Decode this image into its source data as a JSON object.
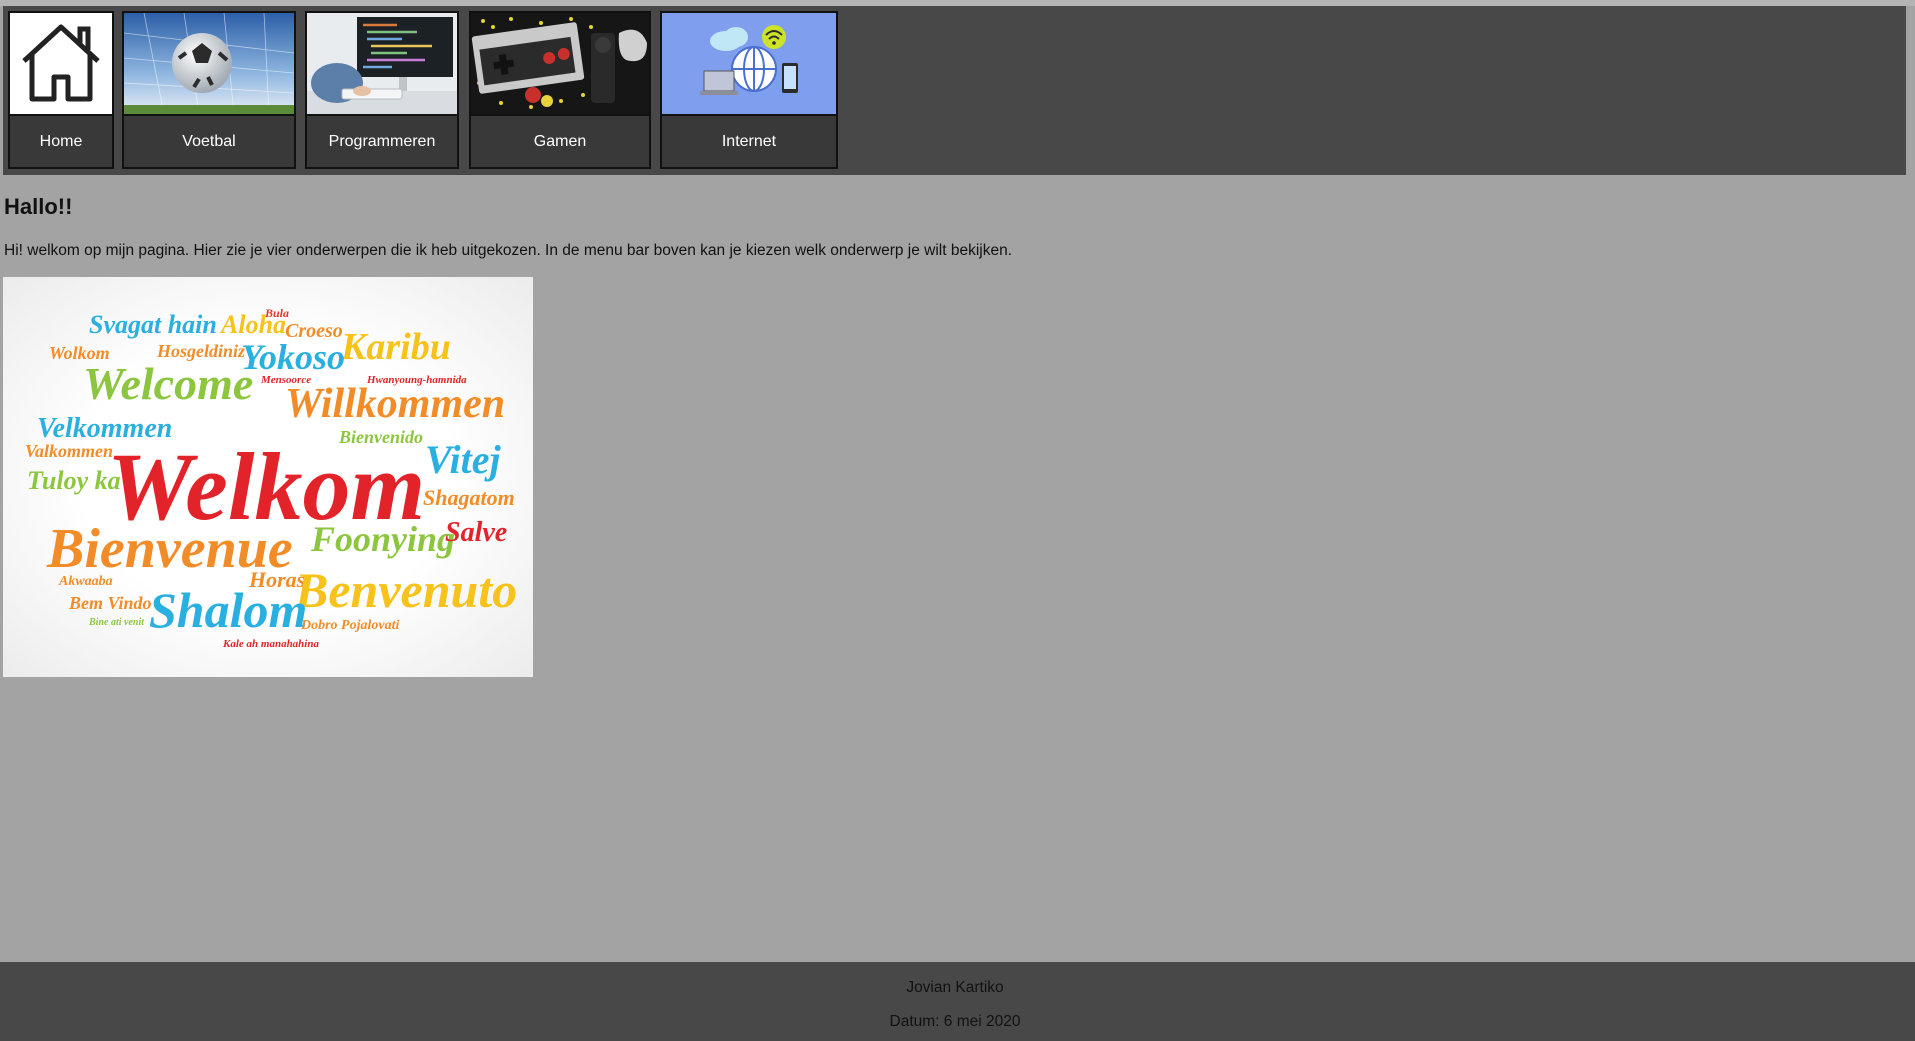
{
  "nav": {
    "items": [
      {
        "label": "Home",
        "icon": "house-icon"
      },
      {
        "label": "Voetbal",
        "icon": "soccer-ball-icon"
      },
      {
        "label": "Programmeren",
        "icon": "programming-icon"
      },
      {
        "label": "Gamen",
        "icon": "game-controller-icon"
      },
      {
        "label": "Internet",
        "icon": "globe-devices-icon"
      }
    ]
  },
  "main": {
    "heading": "Hallo!!",
    "intro": "Hi! welkom op mijn pagina. Hier zie je vier onderwerpen die ik heb uitgekozen. In de menu bar boven kan je kiezen welk onderwerp je wilt bekijken."
  },
  "welcome_cloud": {
    "words": [
      "Svagat hain",
      "Aloha",
      "Bula",
      "Croeso",
      "Karibu",
      "Wolkom",
      "Hosgeldiniz",
      "Yokoso",
      "Welcome",
      "Willkommen",
      "Velkommen",
      "Welkom",
      "Vitej",
      "Bienvenido",
      "Valkommen",
      "Tuloy ka",
      "Shagatom",
      "Bienvenue",
      "Foonying",
      "Salve",
      "Akwaaba",
      "Horas",
      "Benvenuto",
      "Bem Vindo",
      "Shalom",
      "Dobro Pojalovati",
      "Kale ah manahahina",
      "Mensoorce",
      "Hwanyoung-hamnida",
      "Yokoso",
      "Bine ati venit"
    ]
  },
  "footer": {
    "author": "Jovian Kartiko",
    "date": "Datum: 6 mei 2020"
  },
  "colors": {
    "page_bg": "#a3a3a3",
    "bar_bg": "#484848",
    "label_text": "#ffffff"
  }
}
